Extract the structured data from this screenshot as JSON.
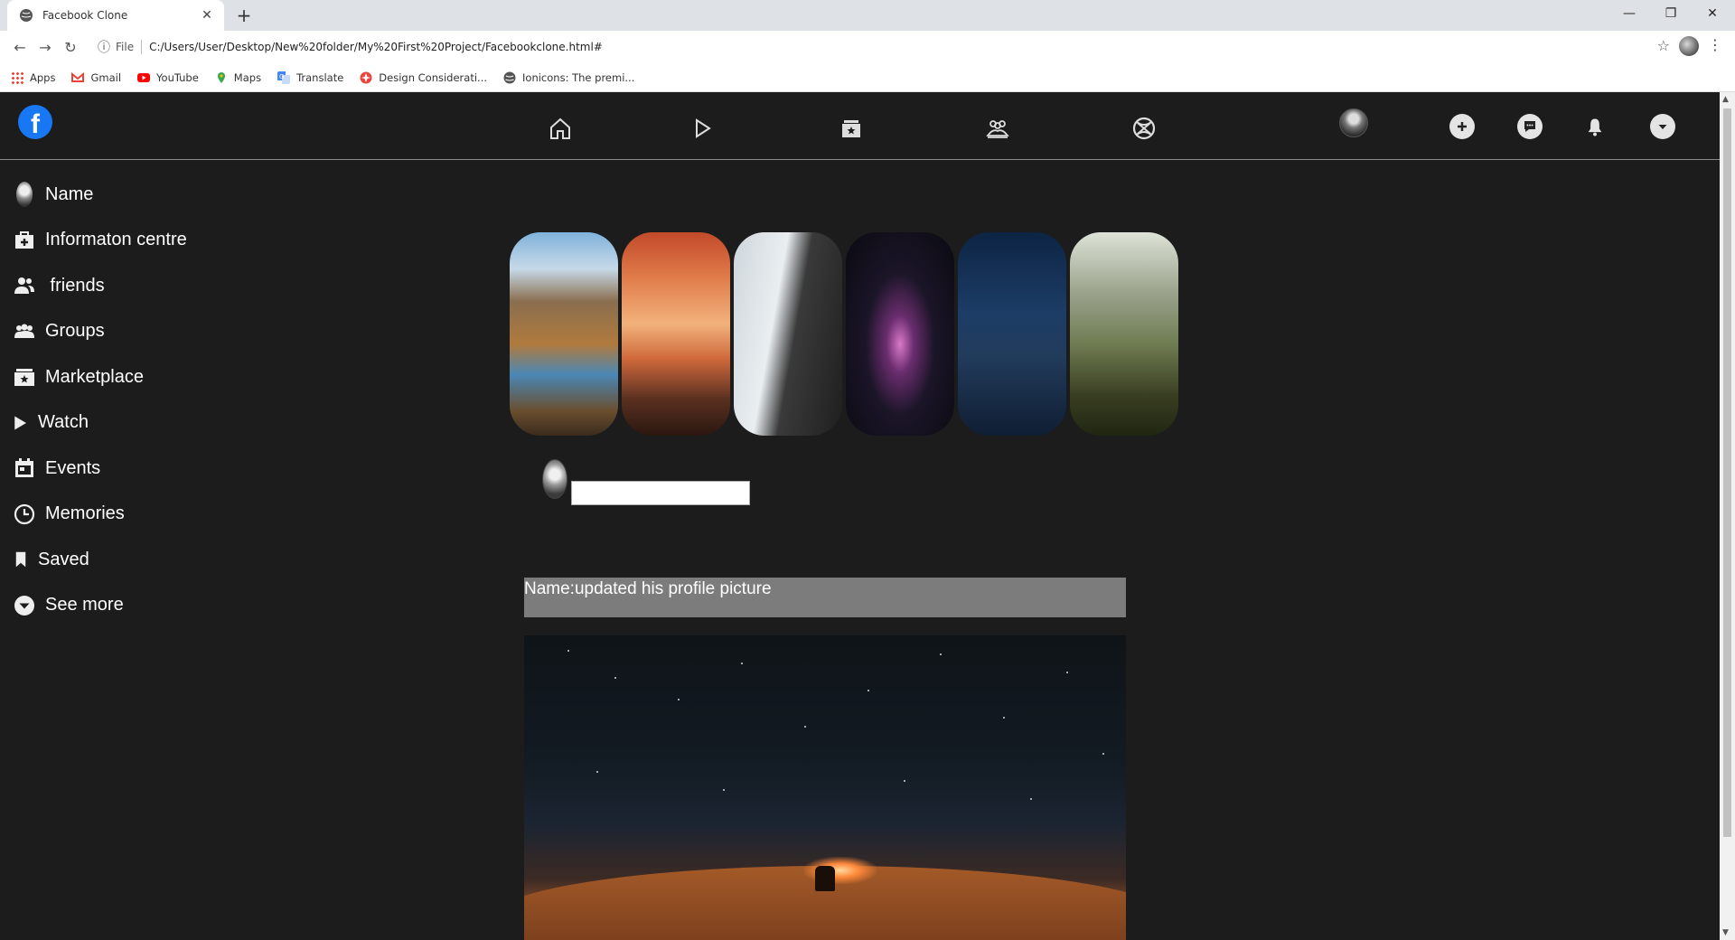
{
  "browser": {
    "tab_title": "Facebook Clone",
    "close_glyph": "✕",
    "newtab_glyph": "+",
    "minimize_glyph": "—",
    "restore_glyph": "❐",
    "close_window_glyph": "✕",
    "back_glyph": "←",
    "forward_glyph": "→",
    "reload_glyph": "↻",
    "info_glyph": "ⓘ",
    "file_label": "File",
    "url": "C:/Users/User/Desktop/New%20folder/My%20First%20Project/Facebookclone.html#",
    "star_glyph": "☆",
    "menu_glyph": "⋮",
    "bookmarks": [
      {
        "label": "Apps",
        "icon": "apps-grid-icon",
        "color": "#4285f4"
      },
      {
        "label": "Gmail",
        "icon": "gmail-icon",
        "color": "#ea4335"
      },
      {
        "label": "YouTube",
        "icon": "youtube-icon",
        "color": "#ff0000"
      },
      {
        "label": "Maps",
        "icon": "maps-icon",
        "color": "#34a853"
      },
      {
        "label": "Translate",
        "icon": "translate-icon",
        "color": "#4285f4"
      },
      {
        "label": "Design Considerati...",
        "icon": "design-icon",
        "color": "#e8453c"
      },
      {
        "label": "Ionicons: The premi...",
        "icon": "globe-icon",
        "color": "#555555"
      }
    ]
  },
  "header": {
    "logo_letter": "f",
    "nav": [
      "home-icon",
      "watch-play-icon",
      "marketplace-icon",
      "groups-icon",
      "gaming-icon"
    ],
    "actions": [
      "add-icon",
      "messenger-icon",
      "bell-icon",
      "caret-down-icon"
    ]
  },
  "sidebar": {
    "items": [
      {
        "label": "Name",
        "icon": "avatar"
      },
      {
        "label": "Informaton centre",
        "icon": "medkit-icon"
      },
      {
        "label": " friends",
        "icon": "friends-icon"
      },
      {
        "label": "Groups",
        "icon": "groups-icon"
      },
      {
        "label": "Marketplace",
        "icon": "marketplace-icon"
      },
      {
        "label": "Watch",
        "icon": "play-icon"
      },
      {
        "label": "Events",
        "icon": "calendar-icon"
      },
      {
        "label": "Memories",
        "icon": "clock-icon"
      },
      {
        "label": "Saved",
        "icon": "bookmark-icon"
      },
      {
        "label": "See more",
        "icon": "chevron-down-circle-icon"
      }
    ]
  },
  "stories": [
    "valley-river",
    "misty-forest",
    "black-beach",
    "nebula",
    "night-mountains",
    "forest-sunrise"
  ],
  "composer": {
    "placeholder": ""
  },
  "post": {
    "header_text": "Name:updated his profile picture"
  },
  "colors": {
    "page_bg": "#1c1c1c",
    "facebook_blue": "#1877f2",
    "post_header_bg": "#7d7c7c"
  }
}
